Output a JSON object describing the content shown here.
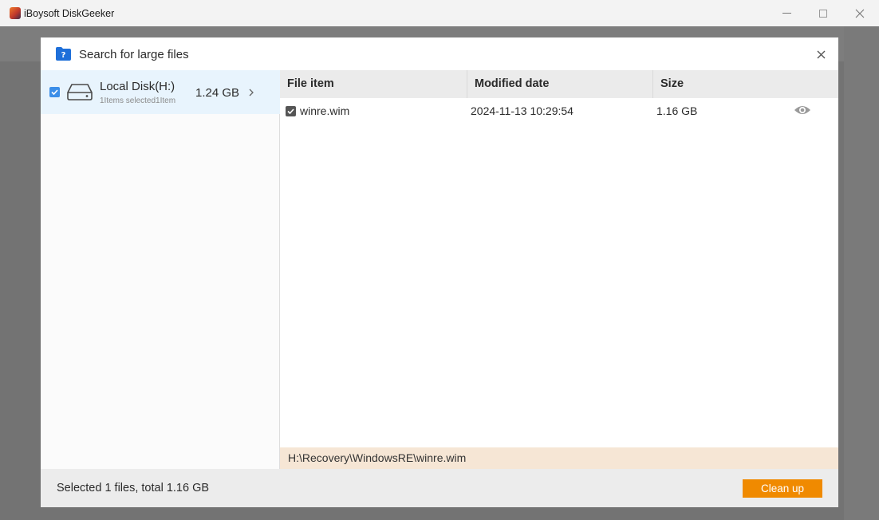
{
  "window": {
    "title": "iBoysoft DiskGeeker"
  },
  "dialog": {
    "title": "Search for large files",
    "close_icon": "close-icon"
  },
  "left_pane": {
    "disk": {
      "checked": true,
      "icon": "hard-drive-icon",
      "name": "Local Disk(H:)",
      "subtitle": "1Items selected1Item",
      "size": "1.24 GB"
    }
  },
  "table": {
    "columns": [
      "File item",
      "Modified date",
      "Size"
    ],
    "rows": [
      {
        "checked": true,
        "name": "winre.wim",
        "modified": "2024-11-13 10:29:54",
        "size": "1.16 GB",
        "action_icon": "eye-icon"
      }
    ]
  },
  "path_bar": {
    "path": "H:\\Recovery\\WindowsRE\\winre.wim"
  },
  "footer": {
    "summary": "Selected 1 files, total 1.16 GB",
    "cleanup_label": "Clean up"
  },
  "colors": {
    "accent": "#f08a00",
    "selection": "#e8f4fd",
    "checkbox": "#3b8ee8",
    "path_bar": "#f6e6d5"
  }
}
